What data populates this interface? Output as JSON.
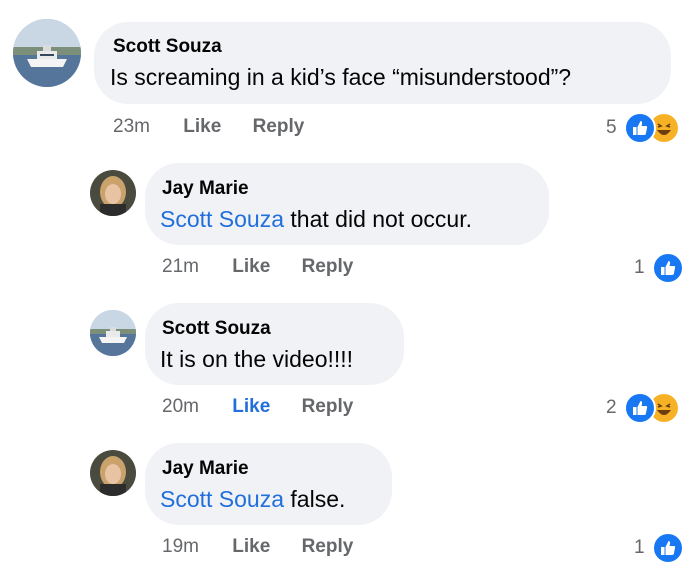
{
  "comments": [
    {
      "author": "Scott Souza",
      "mention": "",
      "text": "Is screaming in a kid’s face “misunderstood”?",
      "time": "23m",
      "like": "Like",
      "reply": "Reply",
      "like_active": false,
      "reaction_count": "5",
      "reactions": [
        "like-icon",
        "haha-icon"
      ]
    },
    {
      "author": "Jay Marie",
      "mention": "Scott Souza",
      "text": " that did not occur.",
      "time": "21m",
      "like": "Like",
      "reply": "Reply",
      "like_active": false,
      "reaction_count": "1",
      "reactions": [
        "like-icon"
      ]
    },
    {
      "author": "Scott Souza",
      "mention": "",
      "text": "It is on the video!!!!",
      "time": "20m",
      "like": "Like",
      "reply": "Reply",
      "like_active": true,
      "reaction_count": "2",
      "reactions": [
        "like-icon",
        "haha-icon"
      ]
    },
    {
      "author": "Jay Marie",
      "mention": "Scott Souza",
      "text": " false.",
      "time": "19m",
      "like": "Like",
      "reply": "Reply",
      "like_active": false,
      "reaction_count": "1",
      "reactions": [
        "like-icon"
      ]
    }
  ],
  "colors": {
    "bubble": "#f0f2f5",
    "mention": "#216fdb",
    "meta": "#65676b",
    "like_reaction": "#1877f2",
    "haha_reaction": "#f7b125"
  }
}
